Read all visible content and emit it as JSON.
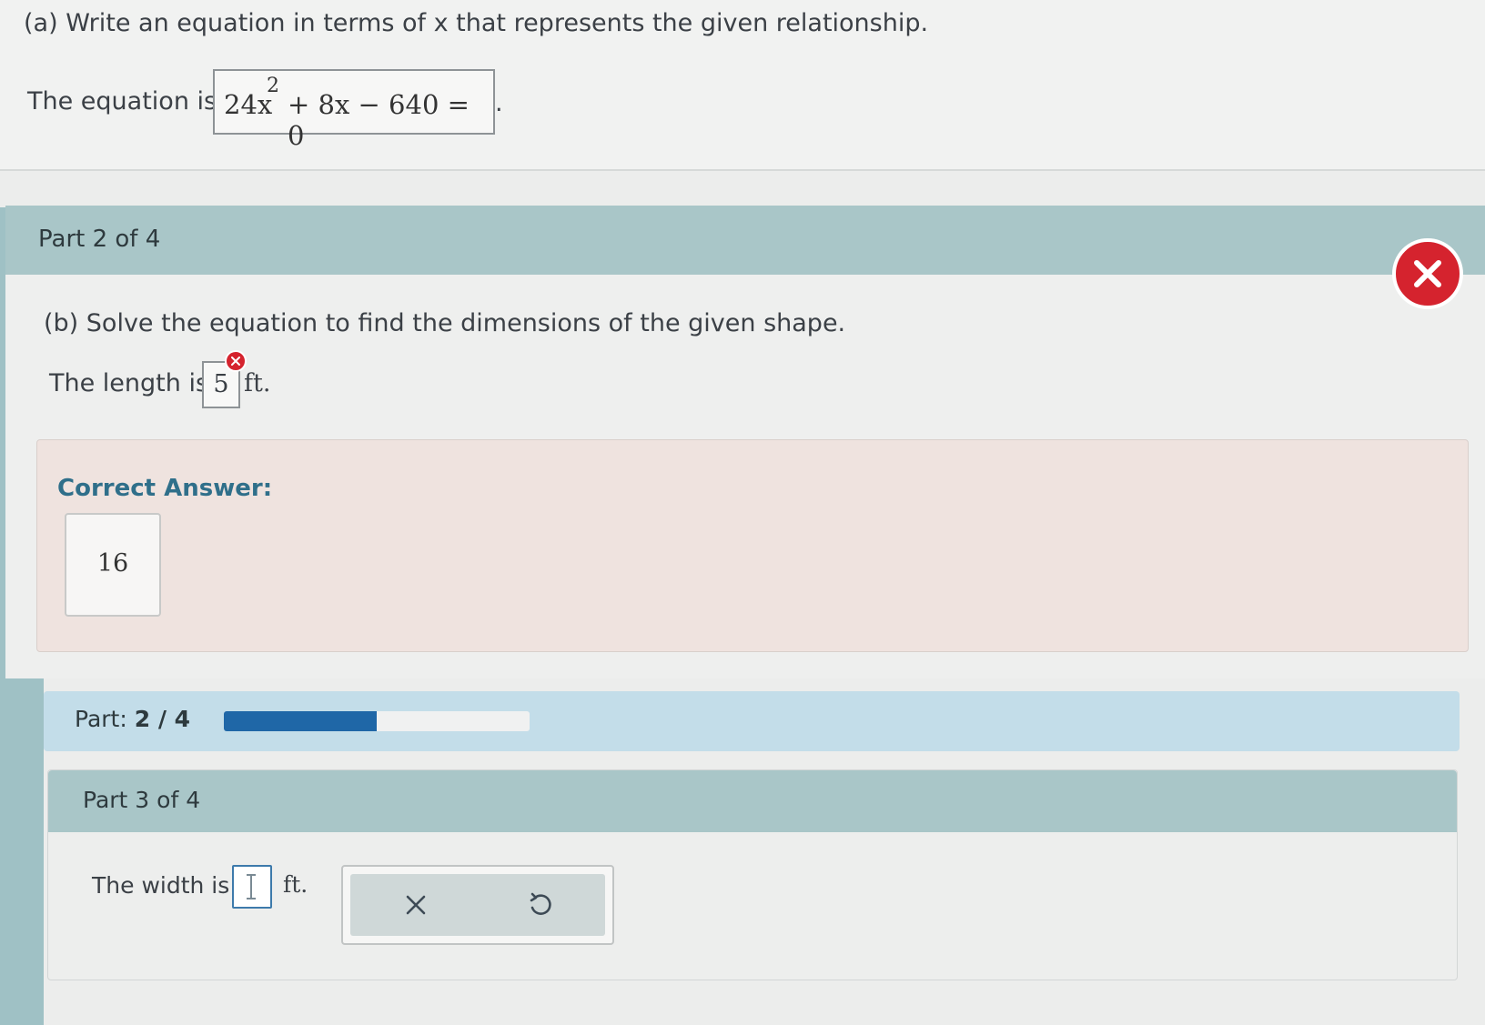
{
  "part_a": {
    "question": "(a) Write an equation in terms of x that represents the given relationship.",
    "equation_label": "The equation is",
    "equation": {
      "coef": "24x",
      "exponent": "2",
      "rest": "+ 8x − 640 = 0"
    },
    "period": "."
  },
  "part2": {
    "title": "Part 2 of 4",
    "question": "(b) Solve the equation to find the dimensions of the given shape.",
    "length_label": "The length is",
    "length_value": "5",
    "length_unit": "ft.",
    "correct_answer_label": "Correct Answer:",
    "correct_answer_value": "16",
    "status_color": "#d5232e"
  },
  "progress": {
    "label": "Part:",
    "value_text": "2 / 4",
    "fraction": 0.5,
    "fill_color": "#1f67a7"
  },
  "part3": {
    "title": "Part 3 of 4",
    "width_label": "The width is",
    "width_value": "",
    "width_unit": "ft.",
    "tools": [
      {
        "icon": "clear-x-icon"
      },
      {
        "icon": "undo-icon"
      }
    ]
  }
}
